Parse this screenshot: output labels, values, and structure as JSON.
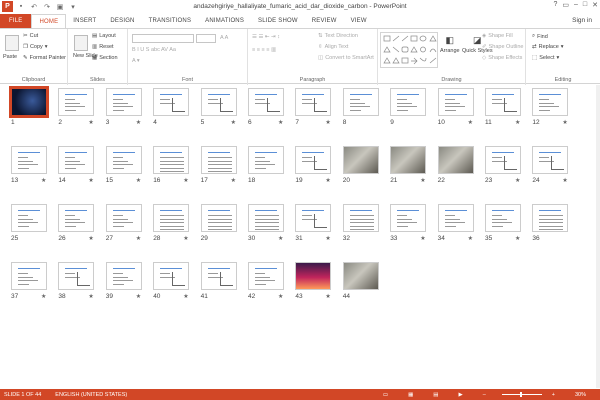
{
  "title_bar": {
    "title": "andazehgiriye_hallaliyate_fumaric_acid_dar_dioxide_carbon - PowerPoint",
    "app_badge": "P"
  },
  "tabs": [
    "FILE",
    "HOME",
    "INSERT",
    "DESIGN",
    "TRANSITIONS",
    "ANIMATIONS",
    "SLIDE SHOW",
    "REVIEW",
    "VIEW"
  ],
  "sign_in": "Sign in",
  "ribbon": {
    "clipboard": {
      "paste": "Paste",
      "cut": "Cut",
      "copy": "Copy",
      "format_painter": "Format Painter",
      "label": "Clipboard"
    },
    "slides": {
      "new_slide": "New Slide",
      "layout": "Layout",
      "reset": "Reset",
      "section": "Section",
      "label": "Slides"
    },
    "font": {
      "label": "Font"
    },
    "paragraph": {
      "text_direction": "Text Direction",
      "align_text": "Align Text",
      "convert": "Convert to SmartArt",
      "label": "Paragraph"
    },
    "drawing": {
      "arrange": "Arrange",
      "quick_styles": "Quick Styles",
      "shape_fill": "Shape Fill",
      "shape_outline": "Shape Outline",
      "shape_effects": "Shape Effects",
      "label": "Drawing"
    },
    "editing": {
      "find": "Find",
      "replace": "Replace",
      "select": "Select",
      "label": "Editing"
    }
  },
  "slides": [
    {
      "n": "1",
      "kind": "dark",
      "star": ""
    },
    {
      "n": "2",
      "kind": "text",
      "star": "★"
    },
    {
      "n": "3",
      "kind": "text",
      "star": "★"
    },
    {
      "n": "4",
      "kind": "chart",
      "star": ""
    },
    {
      "n": "5",
      "kind": "chart",
      "star": "★"
    },
    {
      "n": "6",
      "kind": "chart",
      "star": "★"
    },
    {
      "n": "7",
      "kind": "chart",
      "star": "★"
    },
    {
      "n": "8",
      "kind": "text",
      "star": ""
    },
    {
      "n": "9",
      "kind": "text",
      "star": ""
    },
    {
      "n": "10",
      "kind": "text",
      "star": "★"
    },
    {
      "n": "11",
      "kind": "chart",
      "star": "★"
    },
    {
      "n": "12",
      "kind": "text",
      "star": "★"
    },
    {
      "n": "13",
      "kind": "text",
      "star": "★"
    },
    {
      "n": "14",
      "kind": "text",
      "star": "★"
    },
    {
      "n": "15",
      "kind": "text",
      "star": "★"
    },
    {
      "n": "16",
      "kind": "table",
      "star": "★"
    },
    {
      "n": "17",
      "kind": "table",
      "star": "★"
    },
    {
      "n": "18",
      "kind": "text",
      "star": ""
    },
    {
      "n": "19",
      "kind": "chart",
      "star": "★"
    },
    {
      "n": "20",
      "kind": "photo",
      "star": ""
    },
    {
      "n": "21",
      "kind": "photo",
      "star": "★"
    },
    {
      "n": "22",
      "kind": "photo",
      "star": ""
    },
    {
      "n": "23",
      "kind": "chart",
      "star": "★"
    },
    {
      "n": "24",
      "kind": "chart",
      "star": "★"
    },
    {
      "n": "25",
      "kind": "text",
      "star": ""
    },
    {
      "n": "26",
      "kind": "text",
      "star": "★"
    },
    {
      "n": "27",
      "kind": "text",
      "star": "★"
    },
    {
      "n": "28",
      "kind": "table",
      "star": "★"
    },
    {
      "n": "29",
      "kind": "table",
      "star": ""
    },
    {
      "n": "30",
      "kind": "table",
      "star": "★"
    },
    {
      "n": "31",
      "kind": "chart",
      "star": "★"
    },
    {
      "n": "32",
      "kind": "table",
      "star": ""
    },
    {
      "n": "33",
      "kind": "text",
      "star": "★"
    },
    {
      "n": "34",
      "kind": "text",
      "star": "★"
    },
    {
      "n": "35",
      "kind": "text",
      "star": "★"
    },
    {
      "n": "36",
      "kind": "table",
      "star": ""
    },
    {
      "n": "37",
      "kind": "text",
      "star": "★"
    },
    {
      "n": "38",
      "kind": "chart",
      "star": "★"
    },
    {
      "n": "39",
      "kind": "text",
      "star": "★"
    },
    {
      "n": "40",
      "kind": "chart",
      "star": "★"
    },
    {
      "n": "41",
      "kind": "chart",
      "star": ""
    },
    {
      "n": "42",
      "kind": "text",
      "star": "★"
    },
    {
      "n": "43",
      "kind": "sunset",
      "star": "★"
    },
    {
      "n": "44",
      "kind": "photo",
      "star": ""
    }
  ],
  "status_bar": {
    "slide_info": "SLIDE 1 OF 44",
    "language": "ENGLISH (UNITED STATES)",
    "zoom": "30%"
  },
  "colors": {
    "accent": "#d24726"
  }
}
